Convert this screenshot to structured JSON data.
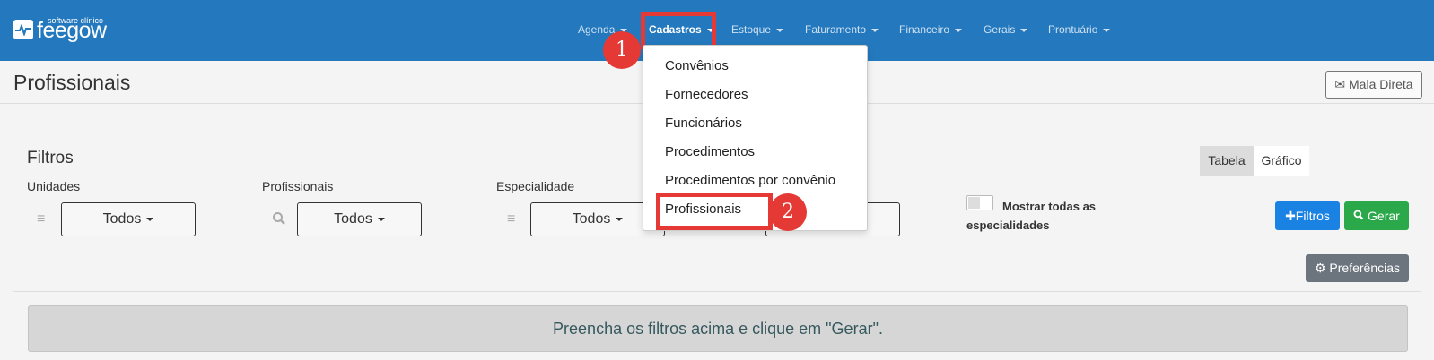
{
  "brand": {
    "tagline": "software clínico",
    "name": "feegow",
    "logo_icon": "heartbeat-icon"
  },
  "nav": {
    "items": [
      {
        "label": "Agenda"
      },
      {
        "label": "Cadastros"
      },
      {
        "label": "Estoque"
      },
      {
        "label": "Faturamento"
      },
      {
        "label": "Financeiro"
      },
      {
        "label": "Gerais"
      },
      {
        "label": "Prontuário"
      }
    ],
    "active": "Cadastros"
  },
  "dropdown": {
    "items": [
      {
        "label": "Convênios"
      },
      {
        "label": "Fornecedores"
      },
      {
        "label": "Funcionários"
      },
      {
        "label": "Procedimentos"
      },
      {
        "label": "Procedimentos por convênio"
      },
      {
        "label": "Profissionais"
      }
    ]
  },
  "annotations": {
    "step1": "1",
    "step2": "2"
  },
  "page": {
    "title": "Profissionais",
    "mala_direta_label": "Mala Direta"
  },
  "filters": {
    "title": "Filtros",
    "unidades": {
      "label": "Unidades",
      "value": "Todos"
    },
    "profissionais": {
      "label": "Profissionais",
      "value": "Todos"
    },
    "especialidade": {
      "label": "Especialidade",
      "value": "Todos"
    },
    "show_all_label": "Mostrar todas as especialidades",
    "view_tabela": "Tabela",
    "view_grafico": "Gráfico",
    "filtros_button": "Filtros",
    "gerar_button": "Gerar",
    "preferencias_button": "Preferências"
  },
  "message": "Preencha os filtros acima e clique em \"Gerar\".",
  "colors": {
    "topbar": "#2479be",
    "highlight": "#e53935",
    "primary": "#1a82e2",
    "success": "#2ba84a"
  }
}
